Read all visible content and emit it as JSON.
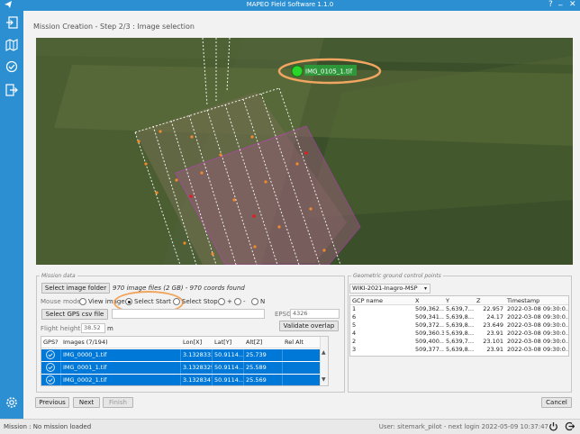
{
  "window": {
    "title": "MAPEO Field Software 1.1.0",
    "help_glyph": "?",
    "min_glyph": "_",
    "close_glyph": "✕"
  },
  "step_title": "Mission Creation - Step 2/3 : Image selection",
  "map": {
    "selected_image_label": "IMG_0105_1.tif"
  },
  "mission_data": {
    "legend": "Mission data",
    "select_folder_label": "Select image folder",
    "folder_info": "970 image files (2 GB) - 970 coords found",
    "mouse_mode_label": "Mouse mode",
    "modes": [
      "View image",
      "Select Start",
      "Select Stop",
      "+",
      "-",
      "N"
    ],
    "selected_mode": "Select Start",
    "select_gps_label": "Select GPS csv file",
    "epsg_label": "EPSG",
    "epsg_value": "4326",
    "flight_height_label": "Flight height:",
    "flight_height_value": "38.52",
    "flight_height_unit": "m",
    "validate_label": "Validate overlap",
    "table": {
      "headers": [
        "GPS?",
        "Images (7/194)",
        "Lon[X]",
        "Lat[Y]",
        "Alt[Z]",
        "Rel Alt"
      ],
      "rows": [
        [
          "IMG_0000_1.tif",
          "3.1328332",
          "50.9114...",
          "25.739",
          ""
        ],
        [
          "IMG_0001_1.tif",
          "3.1328329",
          "50.9114...",
          "25.589",
          ""
        ],
        [
          "IMG_0002_1.tif",
          "3.1328347",
          "50.9114...",
          "25.569",
          ""
        ]
      ]
    }
  },
  "gcp": {
    "legend": "Geometric ground control points",
    "dataset": "WIKI-2021-Inagro-MSP",
    "headers": [
      "GCP name",
      "X",
      "Y",
      "Z",
      "Timestamp"
    ],
    "rows": [
      [
        "1",
        "509,362...",
        "5,639,7...",
        "22.957",
        "2022-03-08 09:30:0..."
      ],
      [
        "6",
        "509,341...",
        "5,639,8...",
        "24.17",
        "2022-03-08 09:30:0..."
      ],
      [
        "5",
        "509,372...",
        "5,639,8...",
        "23.649",
        "2022-03-08 09:30:0..."
      ],
      [
        "4",
        "509,360.3",
        "5,639,8...",
        "23.91",
        "2022-03-08 09:30:0..."
      ],
      [
        "2",
        "509,400...",
        "5,639,7...",
        "23.101",
        "2022-03-08 09:30:0..."
      ],
      [
        "3",
        "509,377...",
        "5,639,8...",
        "23.91",
        "2022-03-08 09:30:0..."
      ]
    ]
  },
  "nav": {
    "previous": "Previous",
    "next": "Next",
    "finish": "Finish",
    "cancel": "Cancel"
  },
  "status": {
    "left": "Mission : No mission loaded",
    "right": "User: sitemark_pilot - next login 2022-05-09 10:37:47"
  },
  "icons": {
    "sidebar": [
      "import-icon",
      "map-icon",
      "check-circle-icon",
      "export-icon",
      "settings-icon"
    ],
    "status": [
      "power-icon",
      "logout-icon"
    ]
  },
  "colors": {
    "accent": "#2b8fd1",
    "selection": "#0078d7",
    "highlight": "#f0a560",
    "polygon": "#d03ad6"
  }
}
